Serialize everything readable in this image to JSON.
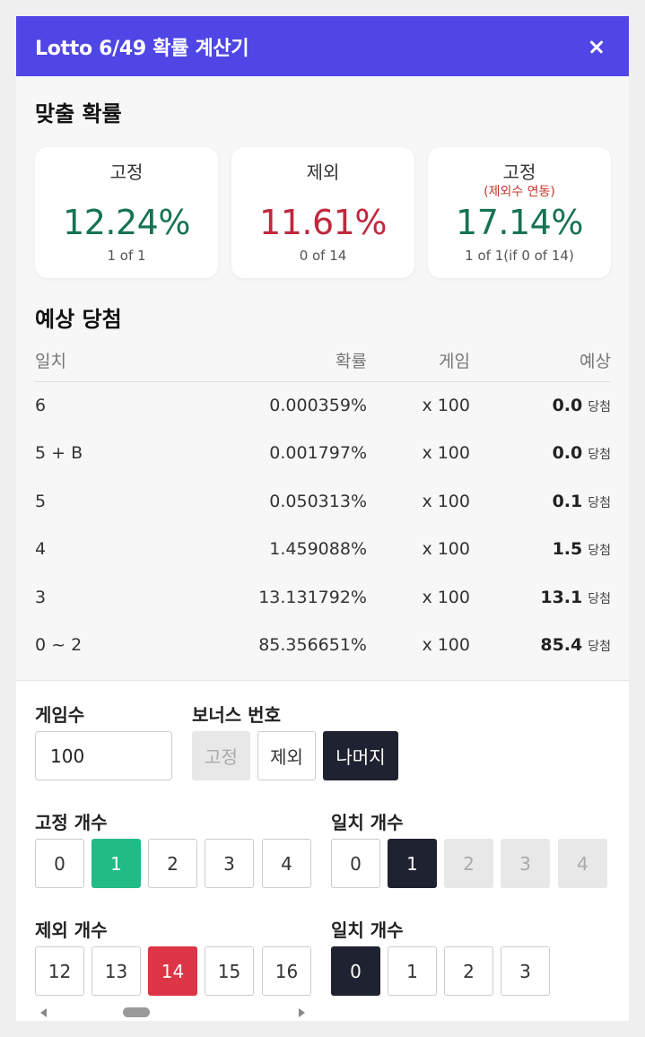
{
  "header": {
    "title": "Lotto 6/49 확률 계산기"
  },
  "probability_section": {
    "title": "맞출 확률",
    "cards": [
      {
        "label": "고정",
        "sub": "",
        "value": "12.24%",
        "foot": "1 of 1"
      },
      {
        "label": "제외",
        "sub": "",
        "value": "11.61%",
        "foot": "0 of 14"
      },
      {
        "label": "고정",
        "sub": "(제외수 연동)",
        "value": "17.14%",
        "foot": "1 of 1(if 0 of 14)"
      }
    ]
  },
  "expected_section": {
    "title": "예상 당첨",
    "columns": [
      "일치",
      "확률",
      "게임",
      "예상"
    ],
    "unit": "당첨",
    "rows": [
      {
        "match": "6",
        "prob": "0.000359%",
        "games": "x 100",
        "expected": "0.0"
      },
      {
        "match": "5 + B",
        "prob": "0.001797%",
        "games": "x 100",
        "expected": "0.0"
      },
      {
        "match": "5",
        "prob": "0.050313%",
        "games": "x 100",
        "expected": "0.1"
      },
      {
        "match": "4",
        "prob": "1.459088%",
        "games": "x 100",
        "expected": "1.5"
      },
      {
        "match": "3",
        "prob": "13.131792%",
        "games": "x 100",
        "expected": "13.1"
      },
      {
        "match": "0 ~ 2",
        "prob": "85.356651%",
        "games": "x 100",
        "expected": "85.4"
      }
    ]
  },
  "controls": {
    "games_label": "게임수",
    "games_value": "100",
    "bonus_label": "보너스 번호",
    "bonus_options": [
      "고정",
      "제외",
      "나머지"
    ],
    "bonus_selected": "나머지",
    "fixed_count_label": "고정 개수",
    "fixed_count_options": [
      "0",
      "1",
      "2",
      "3",
      "4"
    ],
    "fixed_count_selected": "1",
    "match_count_label_1": "일치 개수",
    "match_count_options_1": [
      "0",
      "1",
      "2",
      "3",
      "4"
    ],
    "match_count_selected_1": "1",
    "exclude_count_label": "제외 개수",
    "exclude_count_options": [
      "12",
      "13",
      "14",
      "15",
      "16"
    ],
    "exclude_count_selected": "14",
    "match_count_label_2": "일치 개수",
    "match_count_options_2": [
      "0",
      "1",
      "2",
      "3"
    ],
    "match_count_selected_2": "0"
  },
  "colors": {
    "header_bg": "#4f46e5",
    "fixed_value": "#167354",
    "exclude_value": "#c0283d",
    "selected_green": "#22ba85",
    "selected_red": "#dc3545",
    "selected_dark": "#1f2230"
  }
}
